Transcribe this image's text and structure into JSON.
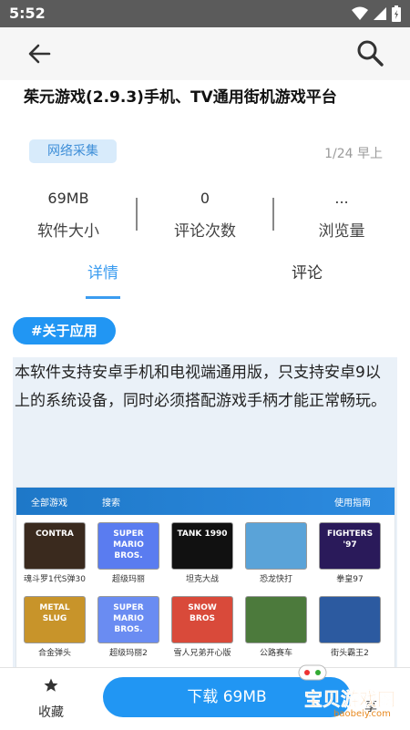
{
  "status_bar": {
    "time": "5:52",
    "icons": [
      "wifi-icon",
      "signal-icon",
      "battery-icon"
    ]
  },
  "app": {
    "title": "茱元游戏(2.9.3)手机、TV通用街机游戏平台",
    "tag": "网络采集",
    "date": "1/24 早上"
  },
  "stats": [
    {
      "value": "69MB",
      "label": "软件大小"
    },
    {
      "value": "0",
      "label": "评论次数"
    },
    {
      "value": "...",
      "label": "浏览量"
    }
  ],
  "tabs": [
    {
      "label": "详情",
      "active": true
    },
    {
      "label": "评论",
      "active": false
    }
  ],
  "section": {
    "label": "#关于应用"
  },
  "description": "本软件支持安卓手机和电视端通用版，只支持安卓9以上的系统设备，同时必须搭配游戏手柄才能正常畅玩。",
  "screenshot": {
    "nav": {
      "all_games": "全部游戏",
      "search": "搜索",
      "guide": "使用指南"
    },
    "games": [
      {
        "name": "魂斗罗1代S弹30",
        "art": "CONTRA",
        "color": "#3a2a1e"
      },
      {
        "name": "超级玛丽",
        "art": "SUPER MARIO BROS.",
        "color": "#5a7cf0"
      },
      {
        "name": "坦克大战",
        "art": "TANK 1990",
        "color": "#111111"
      },
      {
        "name": "恐龙快打",
        "art": "",
        "color": "#5aa3d8"
      },
      {
        "name": "拳皇97",
        "art": "FIGHTERS '97",
        "color": "#2a1a5a"
      },
      {
        "name": "合金弹头",
        "art": "METAL SLUG",
        "color": "#c8942a"
      },
      {
        "name": "超级玛丽2",
        "art": "SUPER MARIO BROS.",
        "color": "#6a8cf2"
      },
      {
        "name": "雪人兄弟开心版",
        "art": "SNOW BROS",
        "color": "#d94a3a"
      },
      {
        "name": "公路赛车",
        "art": "",
        "color": "#4c7a3c"
      },
      {
        "name": "街头霸王2",
        "art": "",
        "color": "#2c5aa0"
      }
    ]
  },
  "bottom": {
    "favorite": "收藏",
    "download": "下载 69MB",
    "share": "享"
  },
  "watermark": {
    "name": "宝贝游戏网",
    "url": "baobeiy.com"
  },
  "colors": {
    "accent": "#2196f3",
    "tag_bg": "#d8ebfb"
  }
}
